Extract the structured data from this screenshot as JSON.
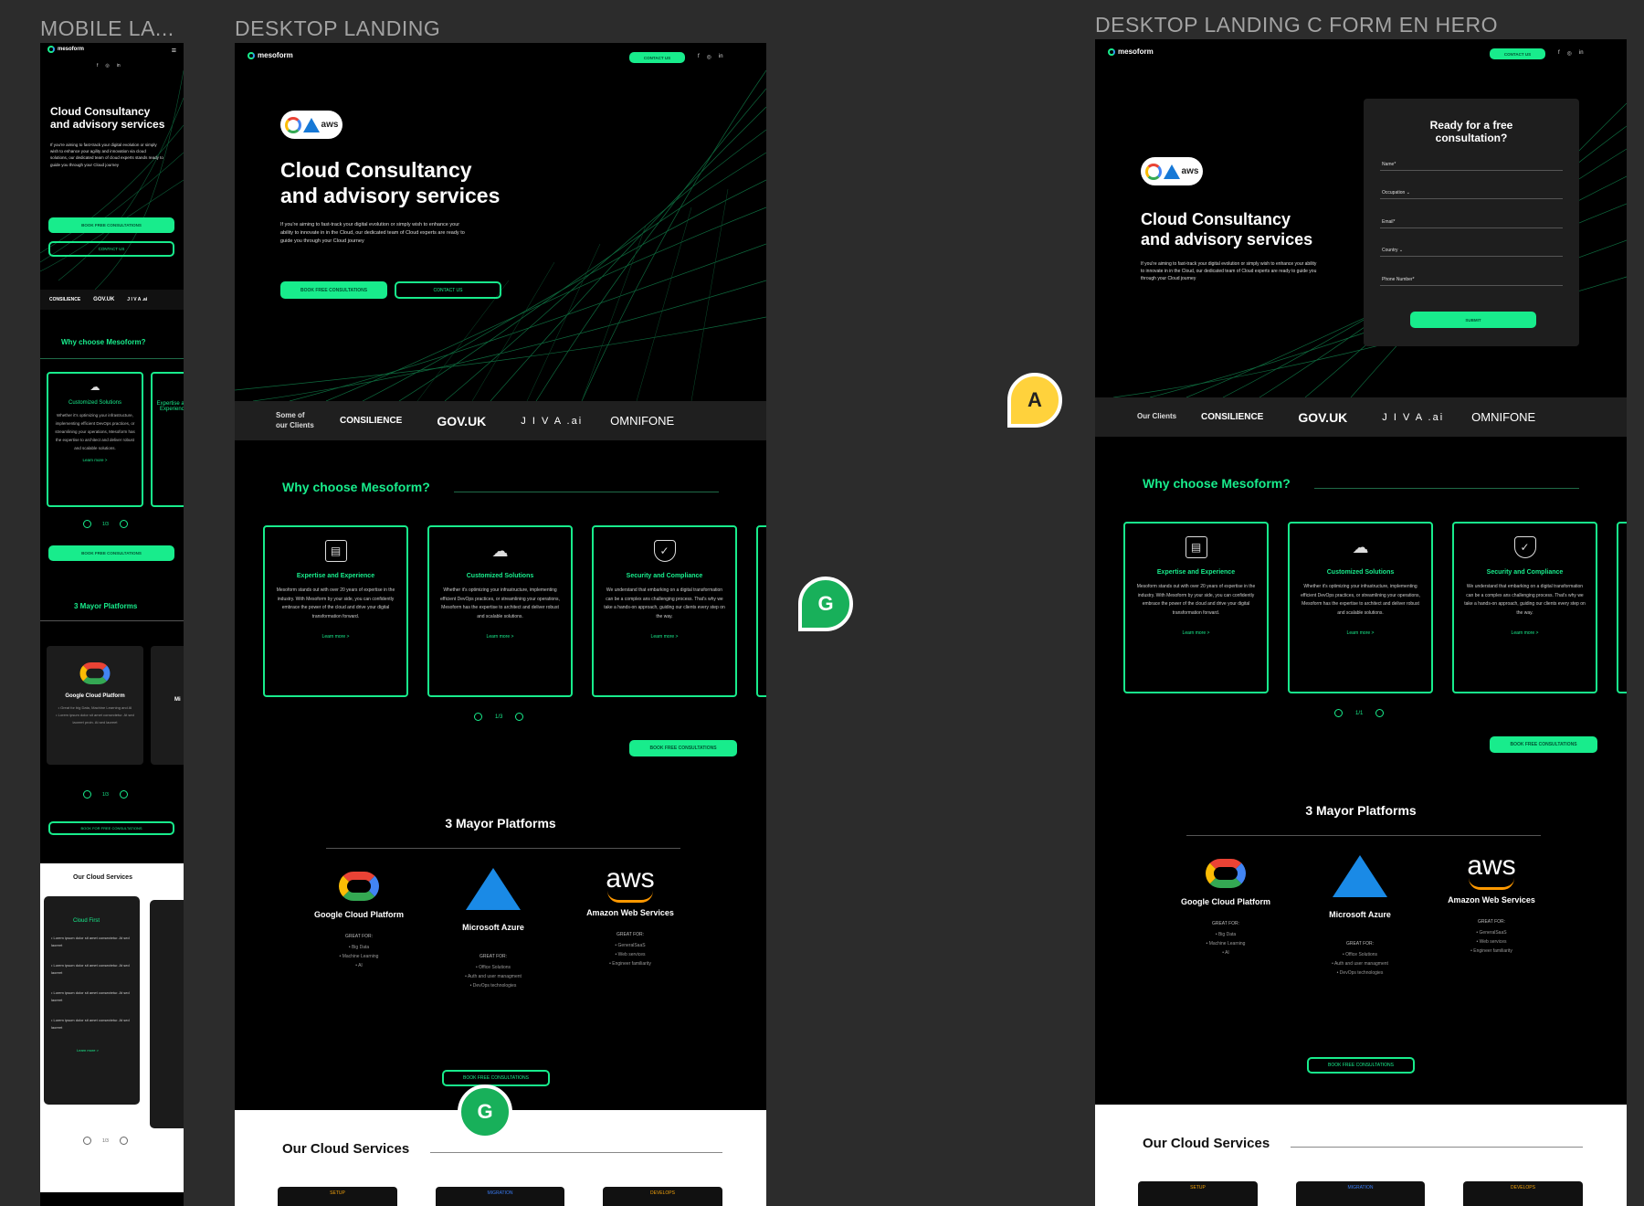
{
  "frames": {
    "mobile": "MOBILE LA...",
    "desktop": "DESKTOP LANDING",
    "form": "DESKTOP LANDING C FORM EN HERO"
  },
  "brand": "mesoform",
  "nav": {
    "contact": "CONTACT US"
  },
  "social": [
    "f",
    "◎",
    "in"
  ],
  "hero": {
    "title_line1": "Cloud Consultancy",
    "title_line2": "and advisory services",
    "desc": "If you're aiming to fast-track your digital evolution or simply wish to enhance your ability to innovate in in the Cloud, our dedicated team of Cloud experts are ready to guide you through your Cloud journey",
    "mobile_desc": "If you're aiming to fast-track your digital evolution or simply wish to enhance your agility and innovation via cloud solutions, our dedicated team of cloud experts stands ready to guide you through your Cloud journey",
    "book": "BOOK FREE CONSULTATIONS",
    "contact": "CONTACT US",
    "badge_aws": "aws"
  },
  "clients": {
    "label_a": "Some of",
    "label_b": "our Clients",
    "label_form": "Our Clients",
    "list": [
      "CONSILIENCE",
      "GOV.UK",
      "J I V A .ai",
      "OMNIFONE"
    ]
  },
  "why": {
    "title": "Why choose Mesoform?",
    "cards": [
      {
        "title": "Expertise and Experience",
        "icon": "▤",
        "desc": "Mesoform stands out with over 20 years of expertise in the industry. With Mesoform by your side, you can confidently embrace the power of the cloud and drive your digital transformation forward.",
        "more": "Learn more >"
      },
      {
        "title": "Customized Solutions",
        "icon": "☁",
        "desc": "Whether it's optimizing your infrastructure, implementing efficient DevOps practices, or streamlining your operations, Mesoform has the expertise to architect and deliver robust and scalable solutions.",
        "more": "Learn more >"
      },
      {
        "title": "Security and Compliance",
        "icon": "✓",
        "desc": "We understand that embarking on a digital transformation can be a complex ans challenging process. That's why we take a hands-on approach, guiding our clients every step on the way.",
        "more": "Learn more >"
      }
    ],
    "pager": "1/3",
    "pager_form": "1/1",
    "book": "BOOK FREE CONSULTATIONS"
  },
  "platforms": {
    "title": "3 Mayor Platforms",
    "great_for": "GREAT FOR:",
    "items": [
      {
        "name": "Google Cloud Platform",
        "uses": [
          "Big Data",
          "Machine Learning",
          "AI"
        ]
      },
      {
        "name": "Microsoft Azure",
        "uses": [
          "Office Solutions",
          "Auth and user managment",
          "DevOps technologies"
        ]
      },
      {
        "name": "Amazon Web Services",
        "uses": [
          "GeneralSaaS",
          "Web services",
          "Engineer familiarity"
        ]
      }
    ],
    "book": "BOOK FREE CONSULTATIONS",
    "mobile_book": "BOOK FOR FREE CONSULTATIONS"
  },
  "services": {
    "title": "Our Cloud Services",
    "tags": [
      "SETUP",
      "MIGRATION",
      "DEVELOPS"
    ],
    "mobile_card_title": "Cloud First",
    "mobile_item": "Lorem ipsum dolor sit amet consectetur. At sed laoreet",
    "more": "Learn more >",
    "pager": "1/3"
  },
  "mobile_platform": {
    "name": "Google Cloud Platform",
    "uses": [
      "Great for big Data, Machine Learning and AI",
      "Lorem ipsum dolor sit amet consectetur. At sed laoreet proin. At sed laoreet"
    ],
    "pager": "1/3",
    "next_name": "Mi"
  },
  "form": {
    "title_line1": "Ready for a free",
    "title_line2": "consultation?",
    "fields": [
      "Name*",
      "Occupation",
      "Email*",
      "Country",
      "Phone Number*"
    ],
    "submit": "SUBMIT"
  },
  "avatars": {
    "a": "A",
    "g": "G"
  }
}
